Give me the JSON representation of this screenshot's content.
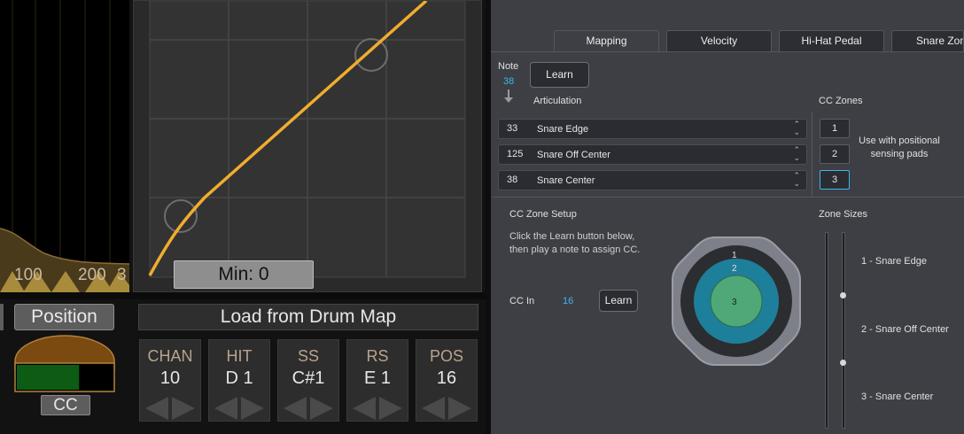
{
  "histogram": {
    "tick_labels": [
      "100",
      "200",
      "3"
    ]
  },
  "curve": {
    "min_label": "Min: 0"
  },
  "left_controls": {
    "position_label": "Position",
    "load_label": "Load from Drum Map",
    "cc_label": "CC",
    "gauge_fill_fraction": 0.65,
    "tiles": [
      {
        "label": "CHAN",
        "value": "10"
      },
      {
        "label": "HIT",
        "value": "D 1"
      },
      {
        "label": "SS",
        "value": "C#1"
      },
      {
        "label": "RS",
        "value": "E 1"
      },
      {
        "label": "POS",
        "value": "16"
      }
    ]
  },
  "tabs": [
    "Mapping",
    "Velocity",
    "Hi-Hat Pedal",
    "Snare Zones"
  ],
  "mapping": {
    "note_label": "Note",
    "note_value": "38",
    "learn_label": "Learn",
    "articulation_header": "Articulation",
    "cc_zones_header": "CC Zones",
    "articulations": [
      {
        "number": "33",
        "name": "Snare Edge"
      },
      {
        "number": "125",
        "name": "Snare Off Center"
      },
      {
        "number": "38",
        "name": "Snare Center"
      }
    ],
    "zone_numbers": [
      "1",
      "2",
      "3"
    ],
    "zone_note": "Use with positional sensing pads"
  },
  "setup": {
    "title": "CC Zone Setup",
    "instructions": "Click the Learn button below, then play a note to assign CC.",
    "cc_in_label": "CC In",
    "cc_in_value": "16",
    "learn_label": "Learn",
    "pad_zone_labels": [
      "1",
      "2",
      "3"
    ]
  },
  "zone_sizes": {
    "title": "Zone Sizes",
    "labels": [
      "1 - Snare Edge",
      "2 - Snare Off Center",
      "3 - Snare Center"
    ]
  },
  "colors": {
    "curve": "#f0ad2e",
    "accent": "#3fb6ea",
    "zone_ring": "#1e7f9a",
    "zone_center": "#4fa878",
    "gauge_fill": "#0e5b14"
  }
}
